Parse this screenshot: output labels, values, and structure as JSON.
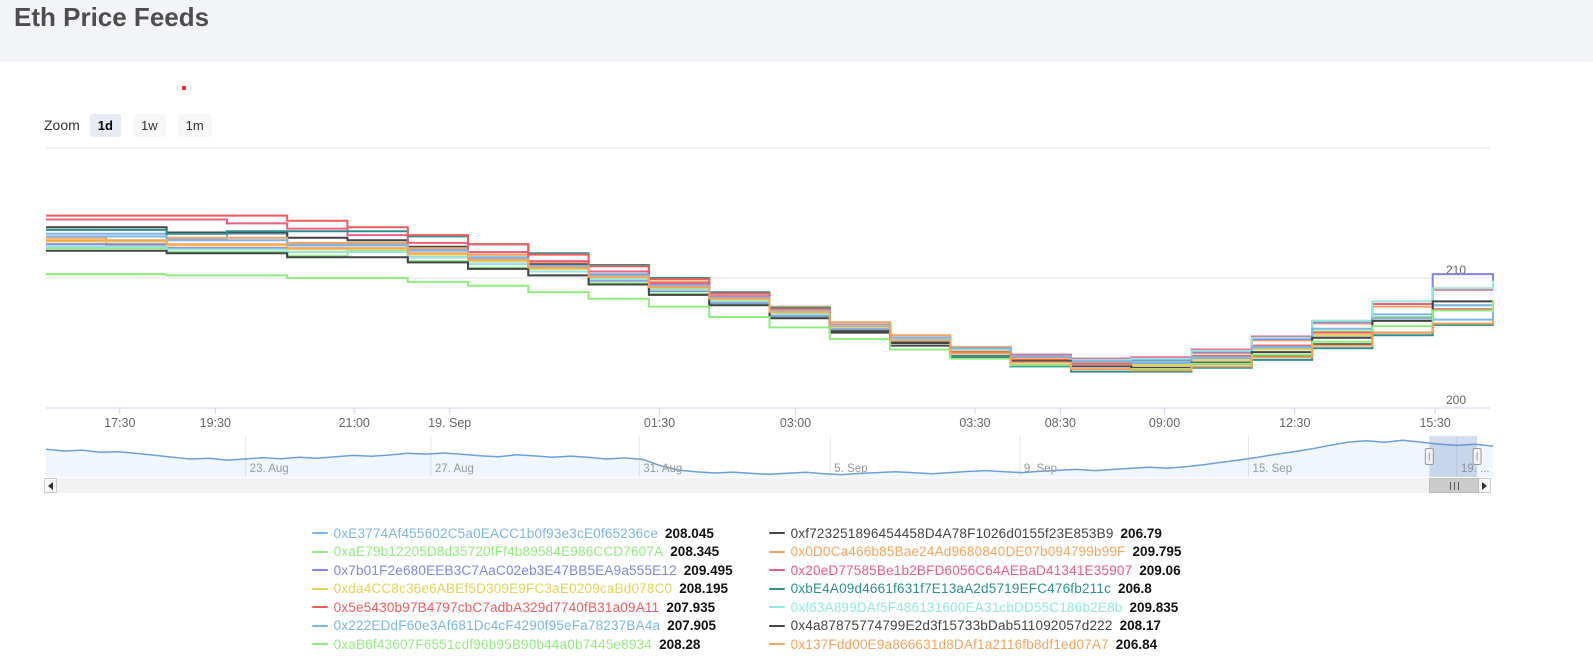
{
  "page": {
    "title": "Eth Price Feeds"
  },
  "toolbar": {
    "zoom_label": "Zoom",
    "buttons": [
      {
        "label": "1d",
        "selected": true
      },
      {
        "label": "1w",
        "selected": false
      },
      {
        "label": "1m",
        "selected": false
      }
    ]
  },
  "chart_data": {
    "type": "line",
    "step": true,
    "title": "",
    "xlabel": "",
    "ylabel": "",
    "grid": true,
    "yaxis": {
      "tick_labels": [
        "210",
        "200"
      ],
      "tick_values": [
        210,
        200
      ],
      "gridline_values": [
        220,
        210,
        200
      ],
      "ylim": [
        199.6,
        220.6
      ],
      "labels_position": "right"
    },
    "xaxis": {
      "tick_labels": [
        "17:30",
        "19:30",
        "21:00",
        "19. Sep",
        "01:30",
        "03:00",
        "03:30",
        "08:30",
        "09:00",
        "12:30",
        "15:30"
      ],
      "tick_fractions": [
        0.051,
        0.117,
        0.213,
        0.279,
        0.424,
        0.518,
        0.642,
        0.701,
        0.773,
        0.863,
        0.96
      ]
    },
    "series": [
      {
        "name": "0xE3774Af455602C5a0EACC1b0f93e3cE0f65236ce",
        "color": "#7cb5ec",
        "current_value": "208.045",
        "values": [
          213.4,
          213.4,
          213.0,
          213.4,
          212.6,
          212.6,
          212.2,
          211.6,
          211.0,
          210.3,
          209.5,
          208.6,
          207.6,
          206.4,
          205.4,
          204.5,
          203.9,
          203.5,
          203.4,
          203.8,
          204.6,
          205.6,
          207.2,
          206.8,
          208.0
        ]
      },
      {
        "name": "0xf723251896454458D4A78F1026d0155f23E853B9",
        "color": "#434348",
        "current_value": "206.79",
        "values": [
          213.9,
          213.9,
          213.5,
          213.5,
          213.1,
          212.9,
          212.4,
          211.8,
          211.1,
          210.2,
          209.2,
          208.2,
          207.0,
          205.8,
          204.8,
          203.9,
          203.3,
          203.0,
          203.0,
          203.4,
          204.0,
          204.9,
          205.8,
          206.4,
          206.8
        ]
      },
      {
        "name": "0xaE79b12205D8d35720fFf4b89584E986CCD7607A",
        "color": "#90ed7d",
        "current_value": "208.345",
        "values": [
          212.3,
          212.3,
          212.0,
          212.0,
          211.7,
          212.1,
          211.3,
          210.8,
          210.2,
          209.6,
          208.8,
          208.0,
          207.0,
          206.0,
          205.1,
          204.3,
          203.8,
          203.5,
          203.6,
          204.0,
          204.8,
          205.9,
          207.0,
          207.9,
          208.3
        ]
      },
      {
        "name": "0x0D0Ca466b85Bae24Ad9680840DE07b094799b99F",
        "color": "#f7a35c",
        "current_value": "209.795",
        "values": [
          213.1,
          212.5,
          213.1,
          213.1,
          212.7,
          212.7,
          212.3,
          211.8,
          211.2,
          210.5,
          209.7,
          208.8,
          207.8,
          206.6,
          205.6,
          204.7,
          204.1,
          203.7,
          203.3,
          204.2,
          205.2,
          206.5,
          207.8,
          209.2,
          209.8
        ]
      },
      {
        "name": "0x7b01F2e680EEB3C7AaC02eb3E47BB5EA9a555E12",
        "color": "#8085e9",
        "current_value": "209.495",
        "values": [
          212.6,
          212.6,
          212.3,
          212.3,
          212.0,
          212.0,
          211.6,
          211.1,
          210.5,
          209.8,
          209.0,
          208.1,
          207.1,
          206.1,
          205.2,
          204.4,
          203.9,
          203.6,
          203.7,
          204.3,
          205.3,
          206.6,
          208.0,
          210.3,
          209.5
        ]
      },
      {
        "name": "0x20eD77585Be1b2BFD6056C64AEBaD41341E35907",
        "color": "#f15c80",
        "current_value": "209.06",
        "values": [
          214.5,
          214.5,
          214.5,
          214.2,
          213.8,
          213.3,
          212.7,
          212.0,
          211.3,
          210.5,
          209.6,
          208.6,
          207.5,
          206.4,
          205.4,
          204.6,
          204.1,
          203.8,
          203.9,
          204.5,
          205.5,
          206.7,
          208.0,
          209.1,
          209.1
        ]
      },
      {
        "name": "0xda4CC8c36e6ABEf5D309E9FC3aE0209caBd078C0",
        "color": "#e4d354",
        "current_value": "208.195",
        "values": [
          212.8,
          212.8,
          212.5,
          212.5,
          212.2,
          212.2,
          211.8,
          211.3,
          210.7,
          210.0,
          209.2,
          208.3,
          207.3,
          206.2,
          205.3,
          204.4,
          203.8,
          203.4,
          203.3,
          203.7,
          204.5,
          205.6,
          206.9,
          207.5,
          208.2
        ]
      },
      {
        "name": "0xbE4A09d4661f631f7E13aA2d5719EFC476fb211c",
        "color": "#2b908f",
        "current_value": "206.8",
        "values": [
          213.7,
          213.7,
          213.4,
          213.6,
          213.6,
          213.6,
          213.2,
          212.6,
          211.9,
          211.0,
          210.0,
          208.9,
          207.7,
          206.3,
          205.1,
          204.0,
          203.2,
          202.8,
          202.8,
          203.1,
          203.7,
          204.6,
          205.6,
          206.4,
          206.8
        ]
      },
      {
        "name": "0x5e5430b97B4797cbC7adbA329d7740fB31a09A11",
        "color": "#f45b5b",
        "current_value": "207.935",
        "values": [
          214.8,
          214.8,
          214.8,
          214.8,
          214.4,
          213.9,
          213.3,
          212.6,
          211.8,
          210.9,
          209.9,
          208.8,
          207.6,
          206.3,
          205.2,
          204.3,
          203.7,
          203.4,
          203.5,
          204.0,
          204.8,
          205.8,
          206.9,
          207.6,
          207.9
        ]
      },
      {
        "name": "0xf63A899DAf5F486131600EA31cbDD55C186b2E8b",
        "color": "#91e8e1",
        "current_value": "209.835",
        "values": [
          212.4,
          212.4,
          212.2,
          212.2,
          212.0,
          212.0,
          211.6,
          211.1,
          210.5,
          209.9,
          209.1,
          208.2,
          207.2,
          206.2,
          205.3,
          204.5,
          204.0,
          203.7,
          203.8,
          204.4,
          205.4,
          206.7,
          208.2,
          209.2,
          209.8
        ]
      },
      {
        "name": "0x222EDdF60e3Af681Dc4cF4290f95eFa78237BA4a",
        "color": "#7cb5ec",
        "current_value": "207.905",
        "values": [
          213.2,
          213.2,
          212.9,
          212.9,
          212.5,
          212.5,
          212.1,
          211.5,
          210.9,
          210.2,
          209.4,
          208.5,
          207.5,
          206.4,
          205.4,
          204.6,
          204.0,
          203.6,
          203.5,
          203.9,
          204.7,
          206.1,
          206.9,
          207.9,
          207.9
        ]
      },
      {
        "name": "0x4a87875774799E2d3f15733bDab511092057d222",
        "color": "#434348",
        "current_value": "208.17",
        "values": [
          212.1,
          212.1,
          211.9,
          211.9,
          211.6,
          211.6,
          211.2,
          210.7,
          210.2,
          209.5,
          208.7,
          207.9,
          206.9,
          205.9,
          205.0,
          204.2,
          203.6,
          203.2,
          203.1,
          203.5,
          204.3,
          205.4,
          206.7,
          208.2,
          208.2
        ]
      },
      {
        "name": "0xaB6f43607F6551cdf96b95B90b44a0b7445e8934",
        "color": "#90ed7d",
        "current_value": "208.28",
        "values": [
          210.3,
          210.3,
          210.2,
          210.2,
          210.0,
          210.0,
          209.7,
          209.4,
          208.9,
          208.4,
          207.8,
          207.0,
          206.2,
          205.3,
          204.5,
          203.8,
          203.3,
          203.0,
          203.0,
          203.4,
          204.1,
          205.1,
          206.3,
          207.5,
          208.3
        ]
      },
      {
        "name": "0x137Fdd00E9a866631d8DAf1a2116fb8df1ed07A7",
        "color": "#f7a35c",
        "current_value": "206.84",
        "values": [
          212.9,
          212.9,
          212.6,
          212.6,
          212.3,
          212.3,
          211.9,
          211.4,
          210.8,
          210.1,
          209.3,
          208.4,
          207.4,
          206.3,
          205.2,
          204.2,
          203.5,
          203.0,
          202.9,
          203.2,
          203.9,
          204.8,
          205.8,
          206.5,
          206.8
        ]
      }
    ],
    "navigator": {
      "date_labels": [
        "23. Aug",
        "27. Aug",
        "31. Aug",
        "5. Sep",
        "9. Sep",
        "15. Sep",
        "19. ..."
      ],
      "date_fractions": [
        0.138,
        0.266,
        0.41,
        0.542,
        0.673,
        0.831,
        0.975
      ],
      "selection_fractions": [
        0.956,
        0.989
      ],
      "line_color": "#6f9fd9",
      "fill_color": "rgba(124,181,236,0.12)",
      "ylim": [
        197.5,
        215.5
      ],
      "values": [
        210,
        209.2,
        209.6,
        208.6,
        208.9,
        208.1,
        207.3,
        206.4,
        205.6,
        205.9,
        205.1,
        205.6,
        206.2,
        205.7,
        206.4,
        205.9,
        206.6,
        207.2,
        206.8,
        207.4,
        208.2,
        207.8,
        208.3,
        207.7,
        207.1,
        206.6,
        207.5,
        207.0,
        206.4,
        206.9,
        206.3,
        205.6,
        206.1,
        205.4,
        202.5,
        200.6,
        199.8,
        199.3,
        199.7,
        199.1,
        198.7,
        199.2,
        199.6,
        199.0,
        198.6,
        199.1,
        199.5,
        199.9,
        199.4,
        199.0,
        199.5,
        200.0,
        200.4,
        199.9,
        199.5,
        200.1,
        200.5,
        200.9,
        200.4,
        200.9,
        201.4,
        201.9,
        201.5,
        202.1,
        203.0,
        204.1,
        205.2,
        206.4,
        207.7,
        208.9,
        210.2,
        211.8,
        213.2,
        213.8,
        213.1,
        214.0,
        213.2,
        212.3,
        211.7,
        212.2,
        211.4
      ]
    }
  },
  "colors": {
    "header_bg": "#f3f4f7",
    "gridline": "#e6e6e6",
    "axis_line": "#ccd6eb",
    "axis_label": "#666666",
    "navigator_label": "#999999",
    "selection_tint": "rgba(102,133,194,0.28)"
  }
}
